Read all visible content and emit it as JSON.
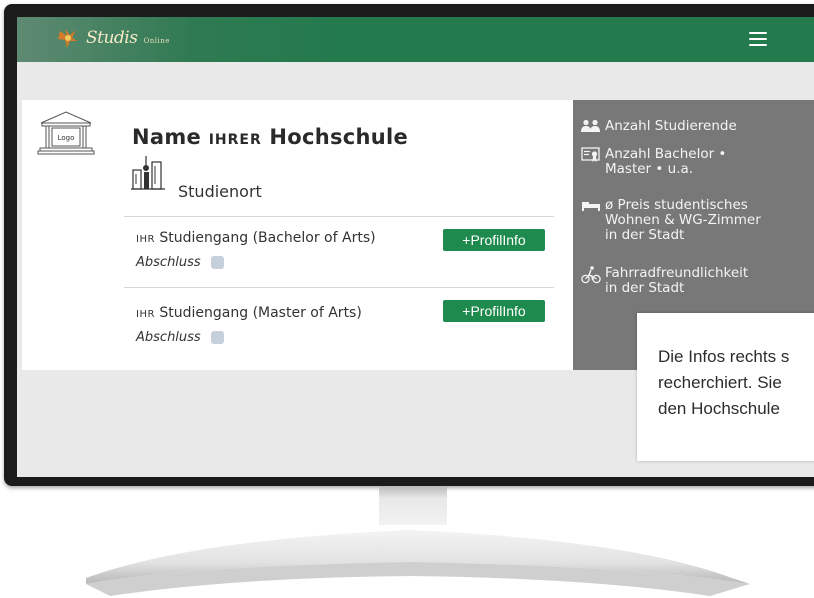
{
  "header": {
    "brand_name": "Studis",
    "brand_sub": "Online"
  },
  "card": {
    "logo_label": "Logo",
    "title_name": "Name",
    "title_ihrer": "Ihrer",
    "title_hochschule": "Hochschule",
    "studienort": "Studienort",
    "courses": [
      {
        "prefix": "Ihr",
        "name": "Studiengang (Bachelor of Arts)",
        "abschluss": "Abschluss",
        "button": "+ProfilInfo"
      },
      {
        "prefix": "Ihr",
        "name": "Studiengang (Master of Arts)",
        "abschluss": "Abschluss",
        "button": "+ProfilInfo"
      }
    ]
  },
  "side_panel": {
    "items": [
      {
        "icon": "people-icon",
        "lines": [
          "Anzahl Studierende"
        ]
      },
      {
        "icon": "certificate-icon",
        "lines": [
          "Anzahl Bachelor •",
          "Master  • u.a."
        ]
      },
      {
        "icon": "bed-icon",
        "lines": [
          "ø Preis studentisches",
          "Wohnen & WG-Zimmer",
          "in der Stadt"
        ]
      },
      {
        "icon": "bicycle-icon",
        "lines": [
          "Fahrradfreundlichkeit",
          "in der Stadt"
        ]
      }
    ]
  },
  "popup": {
    "lines": [
      "Die Infos rechts s",
      "recherchiert. Sie",
      "den Hochschule"
    ]
  },
  "colors": {
    "header_green": "#237a4d",
    "button_green": "#1f8a4e",
    "side_grey": "#787878"
  }
}
